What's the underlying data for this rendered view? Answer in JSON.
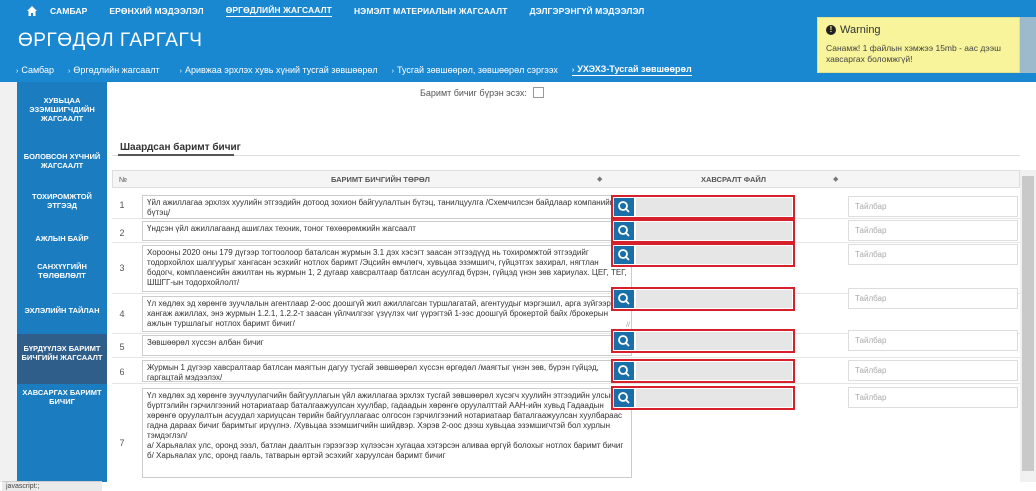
{
  "colors": {
    "header": "#1a87d1",
    "sidebar": "#1b7cc0",
    "sidebar_active": "#2f5e8a",
    "highlight_border": "#d6202c",
    "file_button": "#1b6fa8",
    "toast_bg": "#f7f49b"
  },
  "top_nav": {
    "home_icon": "home-icon",
    "items": [
      {
        "label": "САМБАР"
      },
      {
        "label": "ЕРӨНХИЙ МЭДЭЭЛЭЛ"
      },
      {
        "label": "ӨРГӨДЛИЙН ЖАГСААЛТ"
      },
      {
        "label": "НЭМЭЛТ МАТЕРИАЛЫН ЖАГСААЛТ"
      },
      {
        "label": "ДЭЛГЭРЭНГҮЙ МЭДЭЭЛЭЛ"
      }
    ]
  },
  "page_title": "ӨРГӨДӨЛ ГАРГАГЧ",
  "breadcrumb": [
    {
      "label": "Самбар"
    },
    {
      "label": "Өргөдлийн жагсаалт"
    },
    {
      "label": "Аривжаа эрхлэх хувь хүний тусгай зөвшөөрөл"
    },
    {
      "label": "Тусгай зөвшөөрөл, зөвшөөрөл сэргээх"
    },
    {
      "label": "УХЭХЗ-Тусгай зөвшөөрөл"
    }
  ],
  "sidebar": {
    "items": [
      {
        "label": "ХУВЬЦАА ЭЗЭМШИГЧДИЙН ЖАГСААЛТ"
      },
      {
        "label": "БОЛОВСОН ХҮЧНИЙ ЖАГСААЛТ"
      },
      {
        "label": "ТОХИРОМЖТОЙ ЭТГЭЭД"
      },
      {
        "label": "АЖЛЫН БАЙР"
      },
      {
        "label": "САНХҮҮГИЙН ТӨЛӨВЛӨЛТ"
      },
      {
        "label": "ЭХЛЭЛИЙН ТАЙЛАН"
      },
      {
        "label": "БҮРДҮҮЛЭХ БАРИМТ БИЧГИЙН ЖАГСААЛТ"
      },
      {
        "label": "ХАВСАРГАХ БАРИМТ БИЧИГ"
      }
    ]
  },
  "doc_complete_label": "Баримт бичиг бүрэн эсэх:",
  "section_tab": "Шаардсан баримт бичиг",
  "table": {
    "headers": {
      "num": "№",
      "type": "БАРИМТ БИЧГИЙН ТӨРӨЛ",
      "file": "ХАВСРАЛТ ФАЙЛ"
    },
    "note_placeholder": "Тайлбар",
    "rows": [
      {
        "num": "1",
        "text": "Үйл ажиллагаа эрхлэх хуулийн этгээдийн дотоод зохион байгуулалтын бүтэц, танилцуулга /Схемчилсэн байдлаар компанийн бүтэц/"
      },
      {
        "num": "2",
        "text": "Үндсэн үйл ажиллагаанд ашиглах техник, тоног төхөөрөмжийн жагсаалт"
      },
      {
        "num": "3",
        "text": "Хорооны 2020 оны 179 дүгээр тогтоолоор баталсан журмын 3.1 дэх хэсэгт заасан этгээдүүд нь тохиромжтой этгээдийг тодорхойлох шалгуурыг хангасан эсэхийг нотлох баримт /Эцсийн өмчлөгч, хувьцаа эзэмшигч, гүйцэтгэх захирал, нягтлан бодогч, комплаенсийн ажилтан нь журмын 1, 2 дугаар хавсралтаар батлсан асуулгад бүрэн, гүйцэд үнэн зөв хариулах. ЦЕГ, ТЕГ, ШШГГ-ын тодорхойлолт/"
      },
      {
        "num": "4",
        "text": "Үл хөдлөх эд хөрөнгө зуучлалын агентлаар 2-оос доошгүй жил ажиллагсан туршлагатай, агентуудыг мэргэшил, арга зүйгээр хангаж ажиллах, энэ журмын 1.2.1, 1.2.2-т заасан үйлчилгээг үзүүлэх чиг үүрэгтэй 1-ээс доошгүй брокертой байх /брокерын ажлын туршлагыг нотлох баримт бичиг/"
      },
      {
        "num": "5",
        "text": "Зөвшөөрөл хүссэн албан бичиг"
      },
      {
        "num": "6",
        "text": "Журмын 1 дүгээр хавсралтаар батлсан маягтын дагуу тусгай зөвшөөрөл хүссэн өргөдөл /маягтыг үнэн зөв, бүрэн гүйцэд, гаргацтай мэдээлэх/"
      },
      {
        "num": "7",
        "text": "Үл хөдлөх эд хөрөнгө зуучлуулагчийн байгууллагын үйл ажиллагаа эрхлэх тусгай зөвшөөрөл хүсэгч хуулийн этгээдийн улсын бүртгэлийн гэрчилгээний нотариатаар баталгаажуулсан хуулбар, гадаадын хөрөнгө оруулалттай ААН-ийн хувьд Гадаадын хөрөнгө оруулалтын асуудал хариуцсан төрийн байгууллагаас олгосон гэрчилгээний нотариатаар баталгаажуулсан хуулбараас гадна дараах бичиг баримтыг ирүүлнэ. /Хувьцаа эзэмшигчийн шийдвэр. Хэрэв 2-оос дээш хувьцаа эзэмшигчтэй бол хурлын тэмдэглэл/\nа/ Харьяалах улс, оронд ээзл, батлан даалтын гэрээгээр хүлээсэн хугацаа хэтэрсэн аливаа өргүй болохыг нотлох баримт бичиг\nб/ Харьяалах улс, оронд гааль, татварын өртэй эсэхийг харуулсан баримт бичиг"
      }
    ]
  },
  "toast": {
    "title": "Warning",
    "message": "Санамж! 1 файлын хэмжээ 15mb - аас дээш хавсаргах боломжгүй!"
  },
  "status_bar": "javascript:;"
}
